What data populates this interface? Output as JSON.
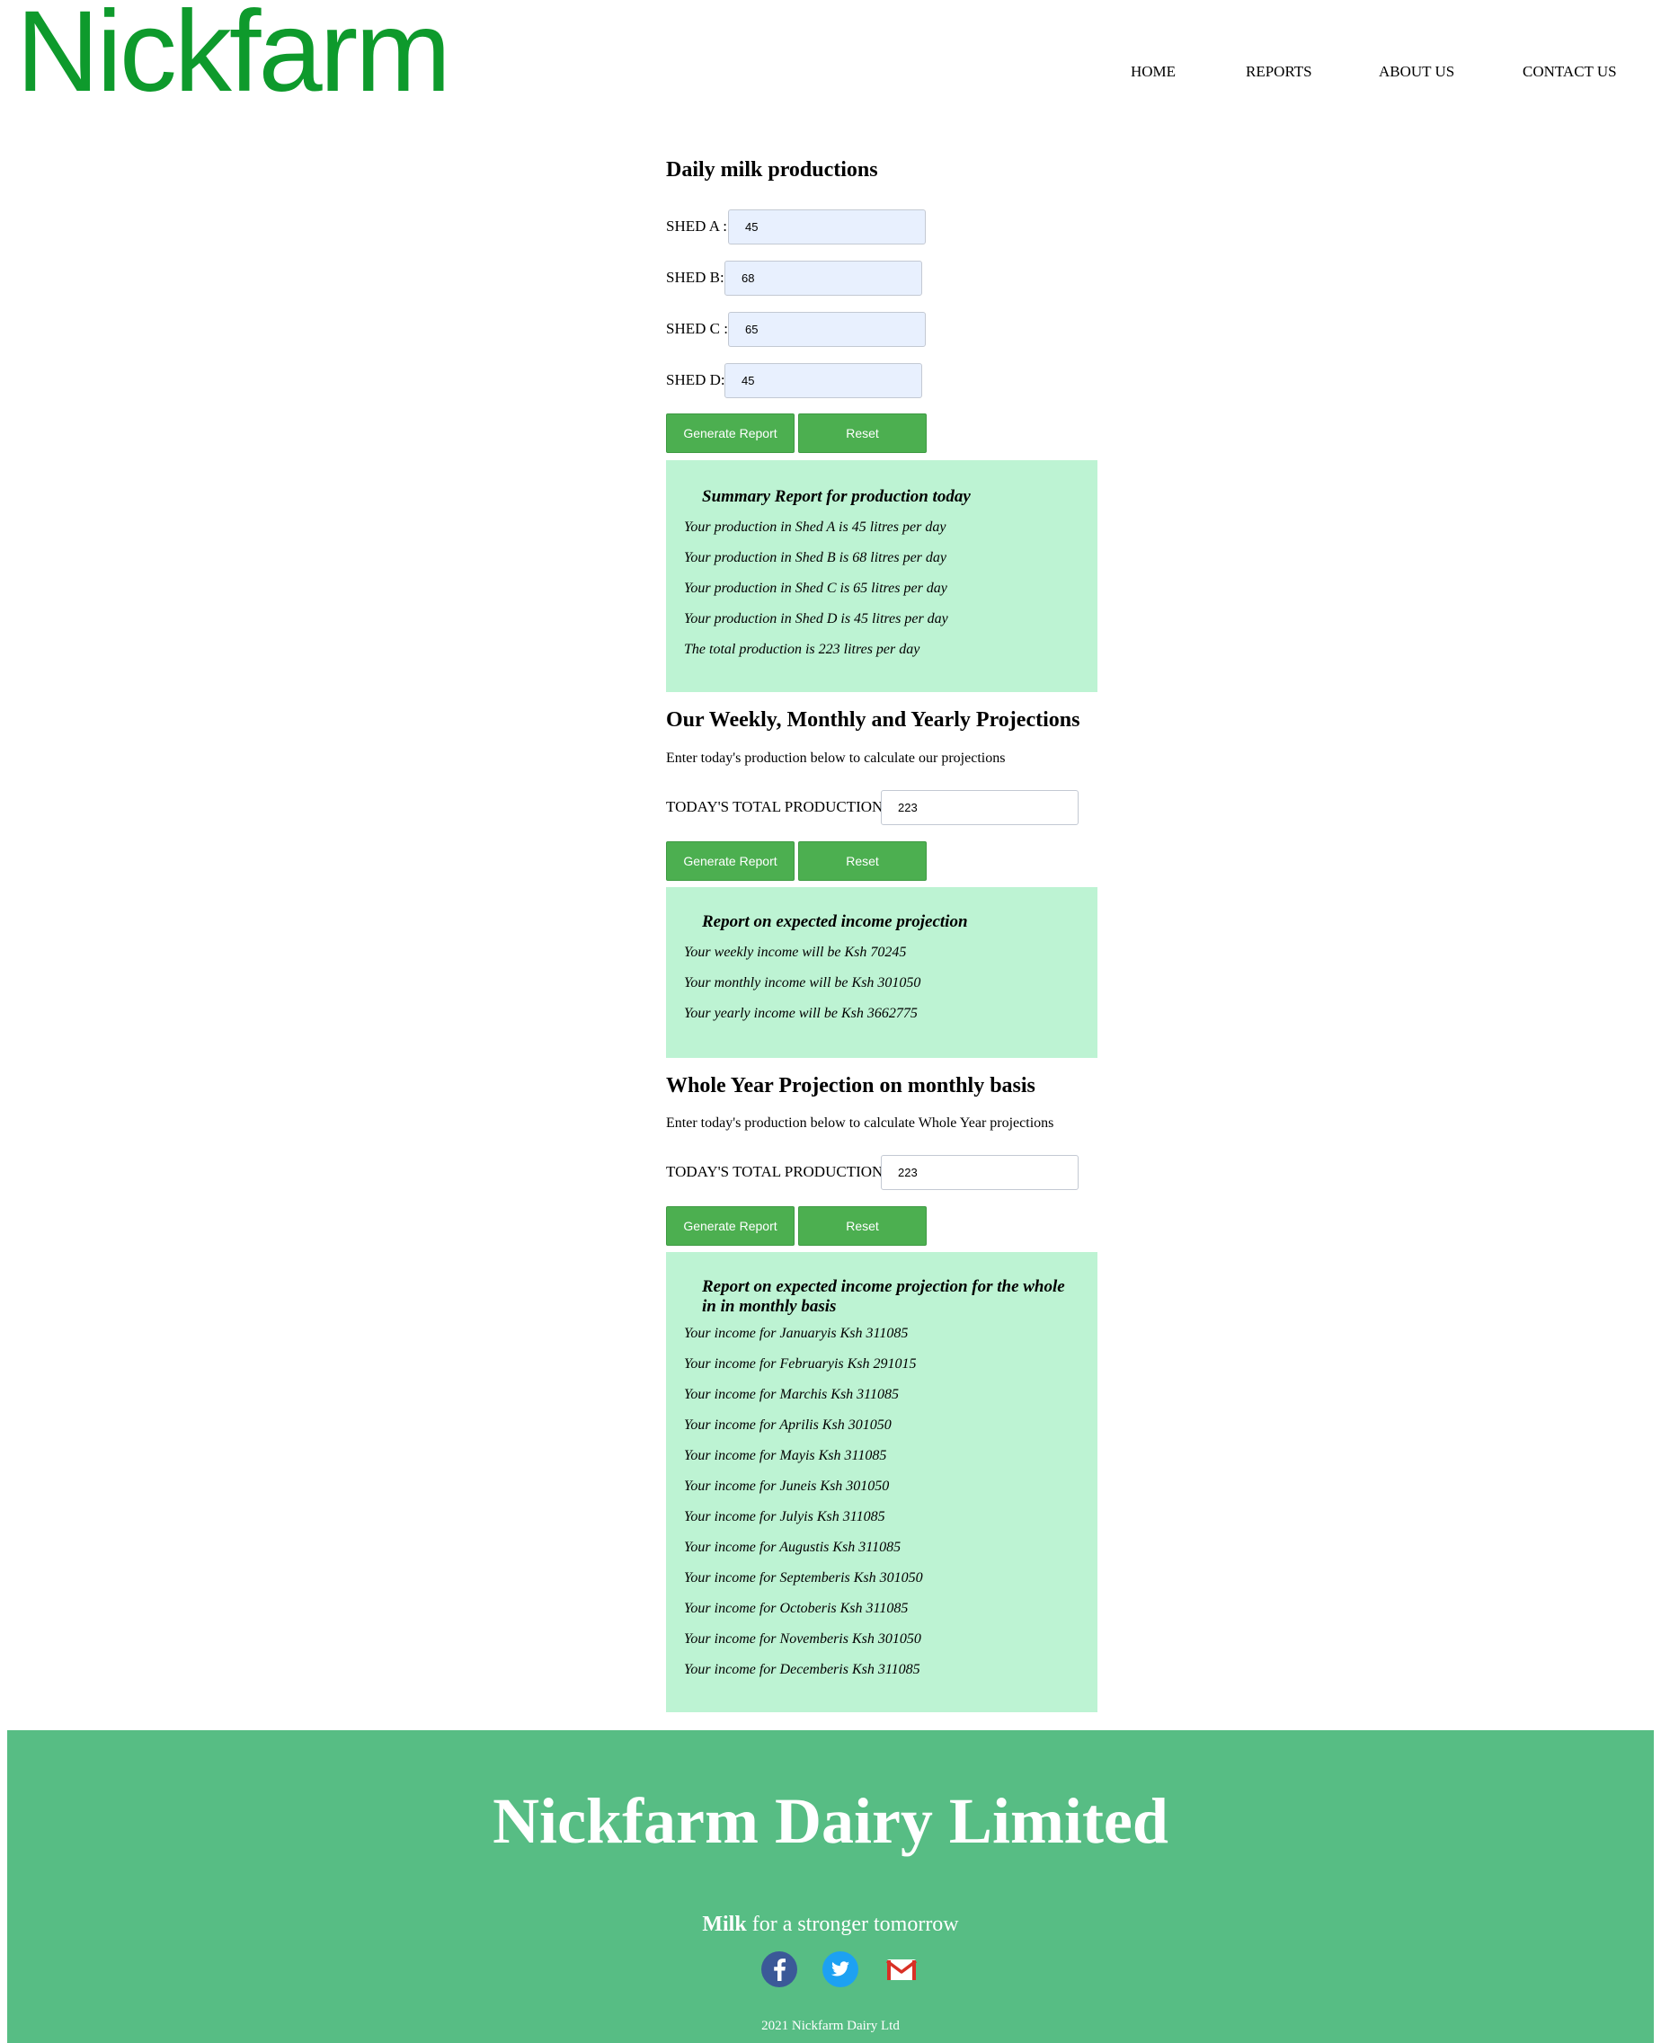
{
  "header": {
    "logo": "Nickfarm",
    "nav": [
      "HOME",
      "REPORTS",
      "ABOUT US",
      "CONTACT US"
    ]
  },
  "daily": {
    "title": "Daily milk productions",
    "sheds": [
      {
        "label": "SHED A :",
        "value": "45"
      },
      {
        "label": "SHED B:",
        "value": "68"
      },
      {
        "label": "SHED C :",
        "value": "65"
      },
      {
        "label": "SHED D:",
        "value": "45"
      }
    ],
    "generate_label": "Generate Report",
    "reset_label": "Reset",
    "report": {
      "title": "Summary Report for production today",
      "lines": [
        "Your production in Shed A is 45 litres per day",
        "Your production in Shed B is 68 litres per day",
        "Your production in Shed C is 65 litres per day",
        "Your production in Shed D is 45 litres per day",
        "The total production is 223 litres per day"
      ]
    }
  },
  "projections": {
    "title": "Our Weekly, Monthly and Yearly Projections",
    "description": "Enter today's production below to calculate our projections",
    "input_label": "TODAY'S TOTAL PRODUCTION :",
    "input_value": "223",
    "generate_label": "Generate Report",
    "reset_label": "Reset",
    "report": {
      "title": "Report on expected income projection",
      "lines": [
        "Your weekly income will be Ksh 70245",
        "Your monthly income will be Ksh 301050",
        "Your yearly income will be Ksh 3662775"
      ]
    }
  },
  "yearly": {
    "title": "Whole Year Projection on monthly basis",
    "description": "Enter today's production below to calculate Whole Year projections",
    "input_label": "TODAY'S TOTAL PRODUCTION :",
    "input_value": "223",
    "generate_label": "Generate Report",
    "reset_label": "Reset",
    "report": {
      "title": "Report on expected income projection for the whole in in monthly basis",
      "lines": [
        "Your income for Januaryis Ksh 311085",
        "Your income for Februaryis Ksh 291015",
        "Your income for Marchis Ksh 311085",
        "Your income for Aprilis Ksh 301050",
        "Your income for Mayis Ksh 311085",
        "Your income for Juneis Ksh 301050",
        "Your income for Julyis Ksh 311085",
        "Your income for Augustis Ksh 311085",
        "Your income for Septemberis Ksh 301050",
        "Your income for Octoberis Ksh 311085",
        "Your income for Novemberis Ksh 301050",
        "Your income for Decemberis Ksh 311085"
      ]
    }
  },
  "footer": {
    "title": "Nickfarm Dairy Limited",
    "tagline_bold": "Milk",
    "tagline_rest": " for a stronger tomorrow",
    "icons": [
      "facebook-icon",
      "twitter-icon",
      "gmail-icon"
    ],
    "copyright": "2021 Nickfarm Dairy Ltd"
  },
  "colors": {
    "brand": "#0e9a2c",
    "button": "#4caf50",
    "panel": "#bdf3d3",
    "footer": "#57bd84",
    "autofill_input": "#e8f0fe"
  }
}
